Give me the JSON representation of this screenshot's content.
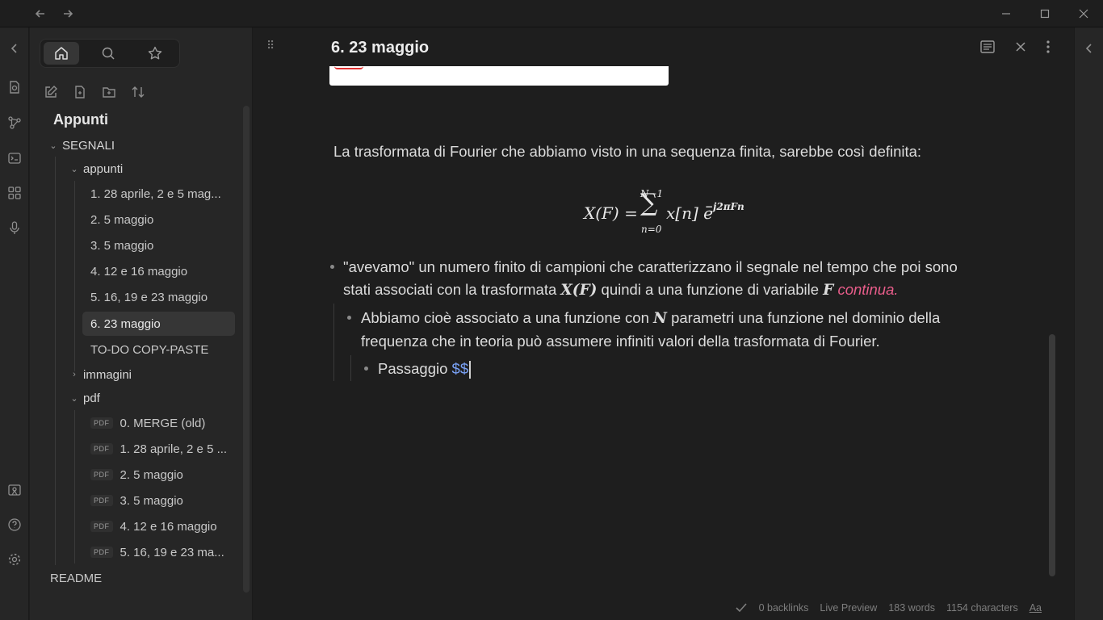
{
  "titlebar": {
    "back_icon": "arrow-left-icon",
    "forward_icon": "arrow-right-icon",
    "minimize_icon": "minimize-icon",
    "maximize_icon": "maximize-icon",
    "close_icon": "close-icon"
  },
  "ribbon": {
    "icons": [
      "collapse-left-icon",
      "search-file-icon",
      "graph-icon",
      "terminal-icon",
      "grid-icon",
      "microphone-icon",
      "vault-icon",
      "help-icon",
      "settings-icon"
    ]
  },
  "sidebar": {
    "tabs": [
      "home-icon",
      "search-icon",
      "star-icon"
    ],
    "actions": [
      "new-note-icon",
      "new-file-icon",
      "new-folder-icon",
      "sort-icon"
    ],
    "vault_title": "Appunti",
    "root_folder": "SEGNALI",
    "appunti_folder": "appunti",
    "appunti_items": [
      "1. 28 aprile, 2 e 5 mag...",
      "2. 5 maggio",
      "3. 5 maggio",
      "4. 12 e 16 maggio",
      "5. 16, 19 e 23 maggio",
      "6. 23 maggio",
      "TO-DO COPY-PASTE"
    ],
    "immagini_folder": "immagini",
    "pdf_folder": "pdf",
    "pdf_badge": "PDF",
    "pdf_items": [
      "0. MERGE (old)",
      "1. 28 aprile, 2 e 5 ...",
      "2. 5 maggio",
      "3. 5 maggio",
      "4. 12 e 16 maggio",
      "5. 16, 19 e 23 ma..."
    ],
    "readme": "README"
  },
  "note": {
    "title": "6. 23 maggio",
    "paragraph": "La trasformata di Fourier che abbiamo visto in una sequenza finita, sarebbe così definita:",
    "formula": {
      "lhs": "X(F) =",
      "sum_upper": "N−1",
      "sum_lower": "n=0",
      "term": "x[n] e",
      "exponent": "−j2πFn"
    },
    "bullet1_a": "\"avevamo\" un numero finito di campioni che caratterizzano il segnale nel tempo che poi sono",
    "bullet1_b_pre": "stati associati con la trasformata",
    "bullet1_b_math": "X(F)",
    "bullet1_b_mid": "quindi a una funzione di variabile",
    "bullet1_b_math2": "F",
    "bullet1_b_italic": "continua.",
    "bullet2_a_pre": "Abbiamo cioè associato a una funzione con",
    "bullet2_a_math": "N",
    "bullet2_a_post": "parametri una funzione nel dominio della",
    "bullet2_b": "frequenza che in teoria può assumere infiniti valori della trasformata di Fourier.",
    "bullet3_text": "Passaggio",
    "bullet3_dollars": "$$"
  },
  "status": {
    "backlinks": "0 backlinks",
    "mode": "Live Preview",
    "words": "183 words",
    "characters": "1154 characters",
    "font": "Aa"
  }
}
